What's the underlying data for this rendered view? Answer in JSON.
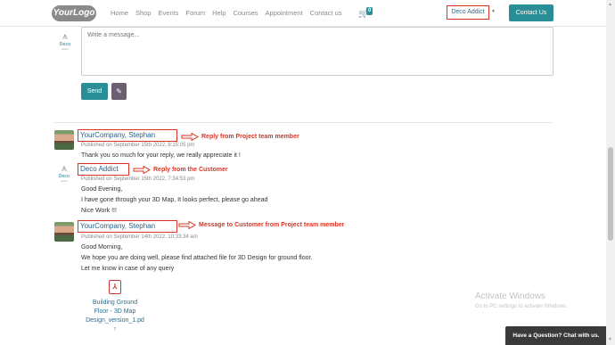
{
  "header": {
    "logo_text": "YourLogo",
    "nav": [
      "Home",
      "Shop",
      "Events",
      "Forum",
      "Help",
      "Courses",
      "Appointment",
      "Contact us"
    ],
    "cart_count": "0",
    "user_label": "Deco Addict",
    "contact_label": "Contact Us"
  },
  "composer": {
    "avatar_brand": "Deco",
    "avatar_sub": "addict",
    "placeholder": "Write a message...",
    "send_label": "Send"
  },
  "messages": [
    {
      "author": "YourCompany, Stephan",
      "annotation": "Reply from Project team member",
      "published": "Published on September 15th 2022, 8:15:05 pm",
      "lines": [
        "Thank you so much for your reply, we really appreciate it !"
      ]
    },
    {
      "author": "Deco Addict",
      "annotation": "Reply from the Customer",
      "published": "Published on September 15th 2022, 7:34:53 pm",
      "lines": [
        "Good Evening,",
        "I have gone through your 3D Map, It looks perfect, please go ahead",
        "Nice Work !!!"
      ]
    },
    {
      "author": "YourCompany, Stephan",
      "annotation": "Message to Customer from Project team member",
      "published": "Published on September 14th 2022, 10:33:34 am",
      "lines": [
        "Good Morning,",
        "We hope you are doing well, please find attached file for 3D Design for ground floor.",
        "Let me know in case of any query"
      ]
    }
  ],
  "attachment": {
    "name_line1": "Building Ground",
    "name_line2": "Floor - 3D Map",
    "name_line3": "Design_version_1.pd",
    "icon": "pdf-icon"
  },
  "watermark": {
    "title": "Activate Windows",
    "subtitle": "Go to PC settings to activate Windows."
  },
  "chat": {
    "label": "Have a Question? Chat with us."
  },
  "colors": {
    "accent": "#2a8e97",
    "annotation": "#dd3322",
    "link": "#2a6e8e"
  }
}
